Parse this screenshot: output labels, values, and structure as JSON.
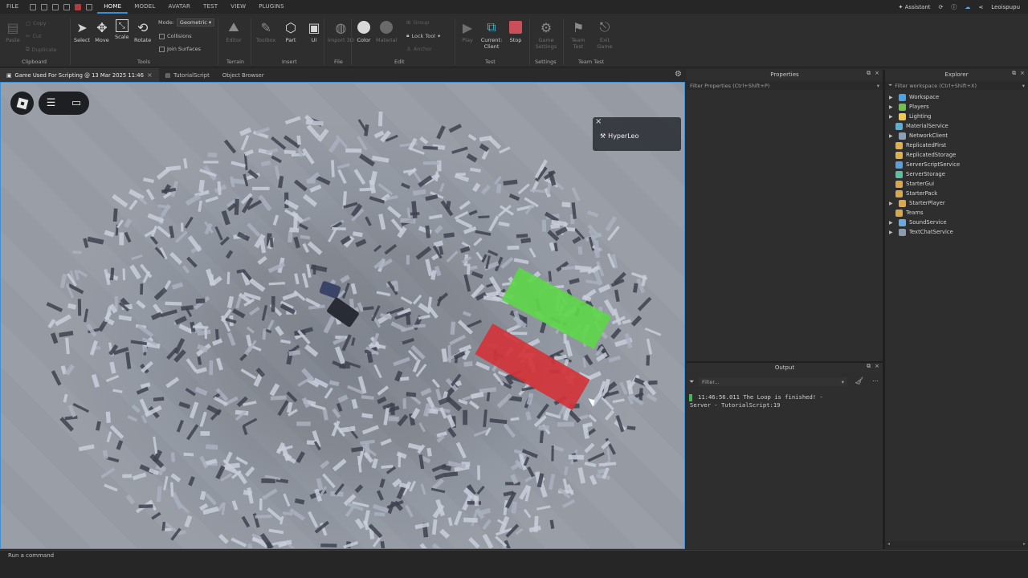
{
  "menu": {
    "items": [
      "FILE",
      "HOME",
      "MODEL",
      "AVATAR",
      "TEST",
      "VIEW",
      "PLUGINS"
    ],
    "active": "HOME",
    "assistant": "Assistant",
    "user": "Leoispupu"
  },
  "ribbon": {
    "clipboard": {
      "paste": "Paste",
      "copy": "Copy",
      "cut": "Cut",
      "duplicate": "Duplicate",
      "group": "Clipboard"
    },
    "tools": {
      "select": "Select",
      "move": "Move",
      "scale": "Scale",
      "rotate": "Rotate",
      "group": "Tools",
      "mode_label": "Mode:",
      "mode_value": "Geometric",
      "collisions": "Collisions",
      "join_surfaces": "Join Surfaces"
    },
    "terrain": {
      "editor": "Editor",
      "group": "Terrain"
    },
    "insert": {
      "toolbox": "Toolbox",
      "part": "Part",
      "ui": "UI",
      "group": "Insert"
    },
    "file": {
      "import3d": "Import 3D",
      "group": "File"
    },
    "edit": {
      "color": "Color",
      "material": "Material",
      "group_btn": "Group",
      "lock_tool": "Lock Tool",
      "anchor": "Anchor",
      "group": "Edit"
    },
    "test": {
      "play": "Play",
      "current_client": "Current: Client",
      "stop": "Stop",
      "group": "Test"
    },
    "settings": {
      "game_settings": "Game Settings",
      "group": "Settings"
    },
    "team_test": {
      "team_test": "Team Test",
      "exit_game": "Exit Game",
      "group": "Team Test"
    }
  },
  "tabs": [
    {
      "label": "Game Used For Scripting @ 13 Mar 2025 11:46",
      "active": true
    },
    {
      "label": "TutorialScript",
      "active": false
    },
    {
      "label": "Object Browser",
      "active": false
    }
  ],
  "viewport": {
    "player_name": "HyperLeo"
  },
  "properties": {
    "title": "Properties",
    "filter_placeholder": "Filter Properties (Ctrl+Shift+P)"
  },
  "explorer": {
    "title": "Explorer",
    "filter_placeholder": "Filter workspace (Ctrl+Shift+X)",
    "items": [
      {
        "label": "Workspace",
        "arrow": true,
        "icon_color": "#4aa3e8"
      },
      {
        "label": "Players",
        "arrow": true,
        "icon_color": "#6cc24a"
      },
      {
        "label": "Lighting",
        "arrow": true,
        "icon_color": "#f2c94c"
      },
      {
        "label": "MaterialService",
        "arrow": false,
        "icon_color": "#5ab0d6"
      },
      {
        "label": "NetworkClient",
        "arrow": true,
        "icon_color": "#8aa0b8"
      },
      {
        "label": "ReplicatedFirst",
        "arrow": false,
        "icon_color": "#e0b04a"
      },
      {
        "label": "ReplicatedStorage",
        "arrow": false,
        "icon_color": "#e0b04a"
      },
      {
        "label": "ServerScriptService",
        "arrow": false,
        "icon_color": "#5aa0e0"
      },
      {
        "label": "ServerStorage",
        "arrow": false,
        "icon_color": "#5ac0a0"
      },
      {
        "label": "StarterGui",
        "arrow": false,
        "icon_color": "#d9a84a"
      },
      {
        "label": "StarterPack",
        "arrow": false,
        "icon_color": "#d9a84a"
      },
      {
        "label": "StarterPlayer",
        "arrow": true,
        "icon_color": "#d9a84a"
      },
      {
        "label": "Teams",
        "arrow": false,
        "icon_color": "#d9a84a"
      },
      {
        "label": "SoundService",
        "arrow": true,
        "icon_color": "#6aa8e0"
      },
      {
        "label": "TextChatService",
        "arrow": true,
        "icon_color": "#8a9ab0"
      }
    ]
  },
  "output": {
    "title": "Output",
    "filter_placeholder": "Filter...",
    "line1": "11:46:56.011  The Loop is finished!  -",
    "line2": "Server - TutorialScript:19"
  },
  "command_bar": {
    "placeholder": "Run a command"
  }
}
